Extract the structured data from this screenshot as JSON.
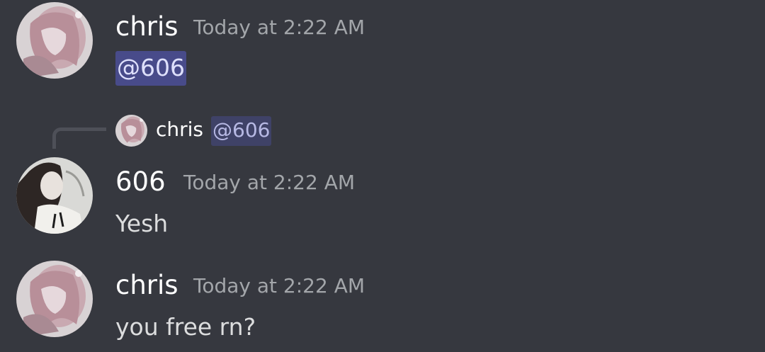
{
  "messages": [
    {
      "author": "chris",
      "timestamp": "Today at 2:22 AM",
      "mention": "@606",
      "avatar_icon": "pink-anime-avatar"
    },
    {
      "reply_to": {
        "author": "chris",
        "text": "@606",
        "avatar_icon": "pink-anime-avatar"
      },
      "author": "606",
      "timestamp": "Today at 2:22 AM",
      "text": "Yesh",
      "avatar_icon": "dark-haired-anime-avatar"
    },
    {
      "author": "chris",
      "timestamp": "Today at 2:22 AM",
      "text": "you free rn?",
      "avatar_icon": "pink-anime-avatar"
    }
  ],
  "colors": {
    "background": "#36383f",
    "username": "#ffffff",
    "timestamp": "#a3a6aa",
    "text": "#dcddde",
    "mention_bg": "#484b8a",
    "mention_text": "#dee0fc"
  }
}
